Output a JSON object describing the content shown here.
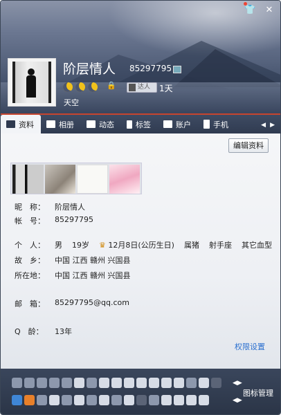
{
  "window": {
    "controls": {
      "skin": "👕",
      "close": "✕"
    }
  },
  "profile": {
    "nickname": "阶层情人",
    "qq_number": "85297795",
    "online_badge": "达人",
    "days": "1天",
    "signature": "天空"
  },
  "tabs": [
    {
      "label": "资料",
      "icon": "card-icon",
      "active": true
    },
    {
      "label": "相册",
      "icon": "album-icon"
    },
    {
      "label": "动态",
      "icon": "feed-icon"
    },
    {
      "label": "标签",
      "icon": "bookmark-icon"
    },
    {
      "label": "账户",
      "icon": "briefcase-icon"
    },
    {
      "label": "手机",
      "icon": "phone-icon"
    }
  ],
  "tab_arrows": {
    "left": "◀",
    "right": "▶"
  },
  "edit_button": "编辑资料",
  "info": {
    "nickname_label": "昵　称：",
    "nickname_value": "阶层情人",
    "account_label": "帐　号：",
    "account_value": "85297795",
    "personal_label": "个　人：",
    "gender": "男",
    "age": "19岁",
    "birthday": "12月8日(公历生日)",
    "zodiac": "属猪",
    "constellation": "射手座",
    "blood": "其它血型",
    "hometown_label": "故　乡：",
    "hometown_value": "中国 江西 赣州 兴国县",
    "location_label": "所在地：",
    "location_value": "中国 江西 赣州 兴国县",
    "email_label": "邮　箱：",
    "email_value": "85297795@qq.com",
    "qage_label": "Q　龄：",
    "qage_value": "13年"
  },
  "permission_link": "权限设置",
  "footer": {
    "manage_label": "图标管理",
    "arrows": "◀▶"
  }
}
